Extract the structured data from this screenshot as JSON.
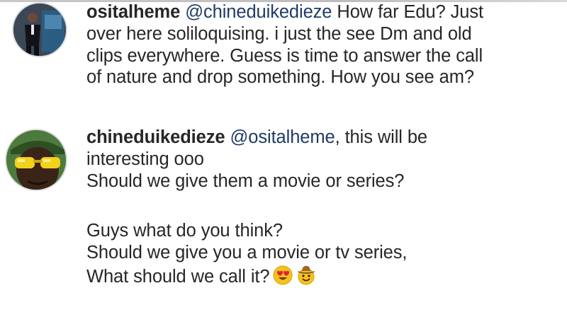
{
  "comments": [
    {
      "username": "ositalheme",
      "mention": "@chineduikedieze",
      "lines": [
        " How far Edu? Just",
        "over here soliloquising. i just the see Dm and old",
        "clips everywhere. Guess is time to answer the call",
        "of nature and drop something. How you see am?"
      ],
      "avatar_icon": "profile-photo-man-in-suit"
    },
    {
      "username": "chineduikedieze",
      "mention": "@ositalheme",
      "lines": [
        ", this will be",
        "interesting ooo",
        "Should we give them a movie or series?",
        "Guys what do you think?",
        "Should we give you a movie or tv series,",
        "What should we call it?"
      ],
      "trailing_emojis": [
        "heart-eyes-emoji",
        "cowboy-emoji"
      ],
      "avatar_icon": "profile-photo-yellow-sunglasses"
    }
  ],
  "colors": {
    "text": "#262626",
    "mention": "#1f3b66"
  }
}
